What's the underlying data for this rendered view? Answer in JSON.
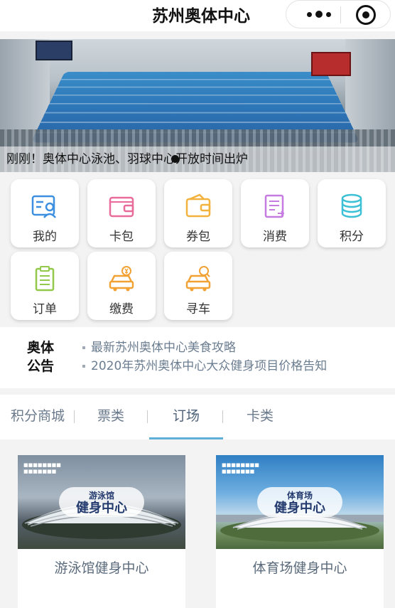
{
  "header": {
    "title": "苏州奥体中心"
  },
  "banner": {
    "caption": "刚刚！奥体中心泳池、羽球中心开放时间出炉"
  },
  "grid": {
    "items": [
      {
        "label": "我的",
        "icon": "user-card-icon",
        "color": "#3d8fe0"
      },
      {
        "label": "卡包",
        "icon": "wallet-icon",
        "color": "#e86b9a"
      },
      {
        "label": "券包",
        "icon": "coupon-wallet-icon",
        "color": "#f2b23d"
      },
      {
        "label": "消费",
        "icon": "receipt-icon",
        "color": "#c57be0"
      },
      {
        "label": "积分",
        "icon": "coins-icon",
        "color": "#3cc0d6"
      },
      {
        "label": "订单",
        "icon": "clipboard-icon",
        "color": "#93c94a"
      },
      {
        "label": "缴费",
        "icon": "car-payment-icon",
        "color": "#f2a234"
      },
      {
        "label": "寻车",
        "icon": "car-search-icon",
        "color": "#f2a234"
      }
    ]
  },
  "notice": {
    "tag": "奥体公告",
    "items": [
      "最新苏州奥体中心美食攻略",
      "2020年苏州奥体中心大众健身项目价格告知"
    ]
  },
  "tabs": [
    "积分商城",
    "票类",
    "订场",
    "卡类"
  ],
  "active_tab": "订场",
  "cards": [
    {
      "name": "游泳馆健身中心",
      "pill_line1": "游泳馆",
      "pill_line2": "健身中心"
    },
    {
      "name": "体育场健身中心",
      "pill_line1": "体育场",
      "pill_line2": "健身中心"
    }
  ]
}
